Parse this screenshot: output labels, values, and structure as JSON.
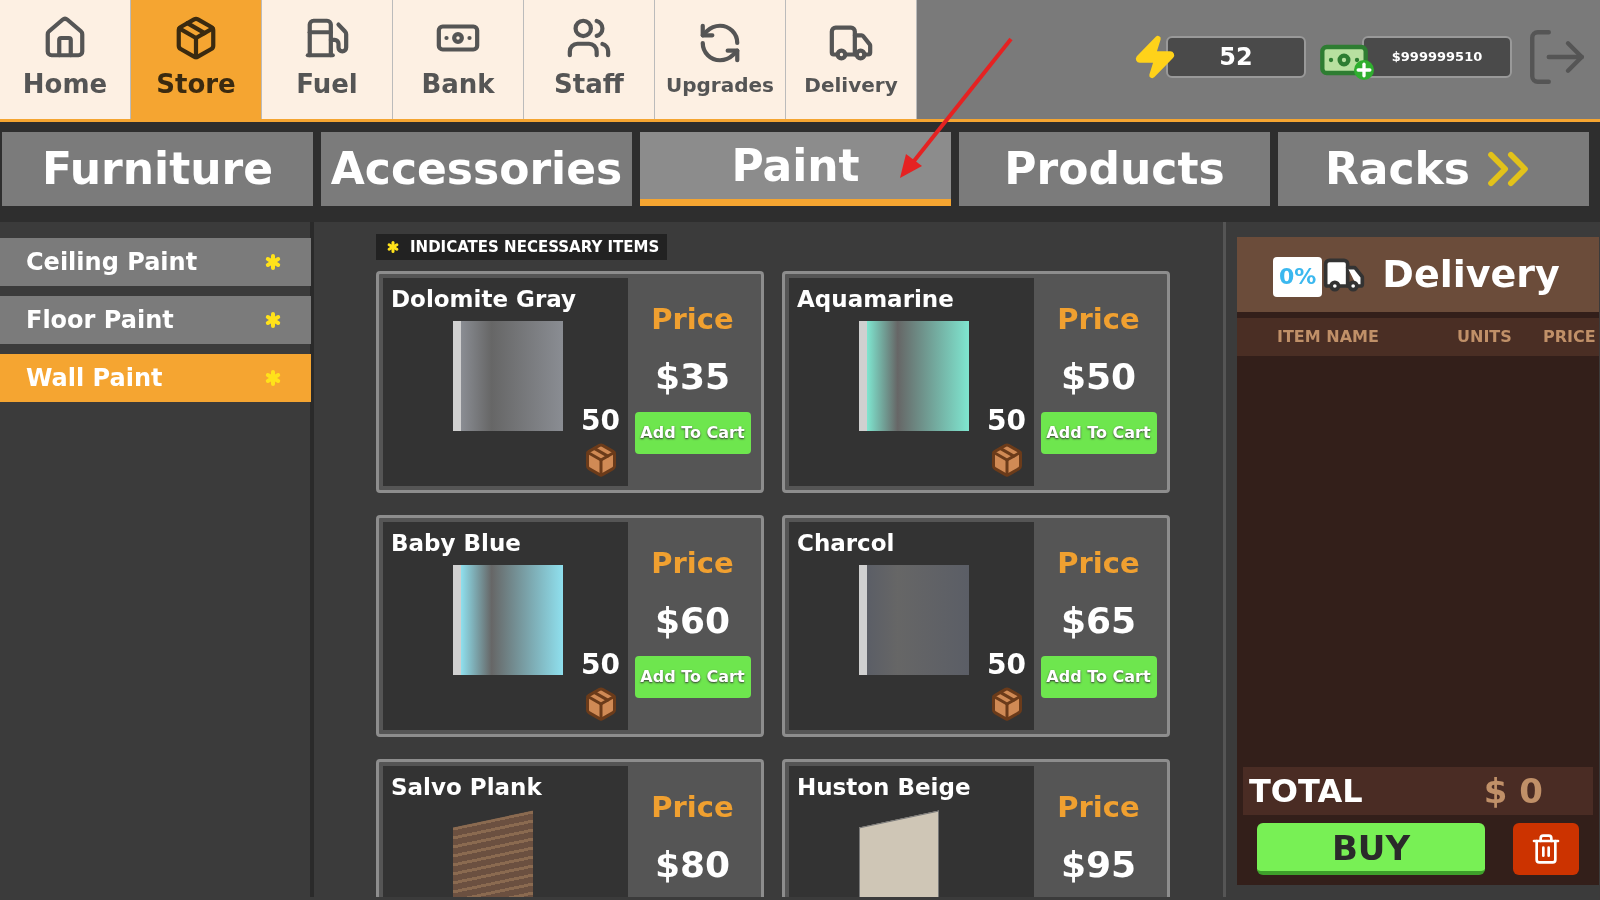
{
  "nav": [
    {
      "label": "Home",
      "selected": false
    },
    {
      "label": "Store",
      "selected": true
    },
    {
      "label": "Fuel",
      "selected": false
    },
    {
      "label": "Bank",
      "selected": false
    },
    {
      "label": "Staff",
      "selected": false
    },
    {
      "label": "Upgrades",
      "selected": false
    },
    {
      "label": "Delivery",
      "selected": false
    }
  ],
  "stats": {
    "energy": "52",
    "money": "$999999510"
  },
  "tabs": [
    {
      "label": "Furniture",
      "selected": false
    },
    {
      "label": "Accessories",
      "selected": false
    },
    {
      "label": "Paint",
      "selected": true
    },
    {
      "label": "Products",
      "selected": false
    },
    {
      "label": "Racks",
      "selected": false,
      "more": true
    }
  ],
  "sidebar": [
    {
      "label": "Ceiling Paint",
      "selected": false
    },
    {
      "label": "Floor Paint",
      "selected": false
    },
    {
      "label": "Wall Paint",
      "selected": true
    }
  ],
  "notice": "INDICATES NECESSARY ITEMS",
  "cards": [
    {
      "name": "Dolomite Gray",
      "kind": "panel",
      "color": "#8a8d93",
      "price_label": "Price",
      "price": "$35",
      "quantity": "50",
      "button": "Add To Cart"
    },
    {
      "name": "Aquamarine",
      "kind": "panel",
      "color": "#7fe6d0",
      "price_label": "Price",
      "price": "$50",
      "quantity": "50",
      "button": "Add To Cart"
    },
    {
      "name": "Baby Blue",
      "kind": "panel",
      "color": "#8fe0ee",
      "price_label": "Price",
      "price": "$60",
      "quantity": "50",
      "button": "Add To Cart"
    },
    {
      "name": "Charcol",
      "kind": "panel",
      "color": "#5b5e66",
      "price_label": "Price",
      "price": "$65",
      "quantity": "50",
      "button": "Add To Cart"
    },
    {
      "name": "Salvo Plank",
      "kind": "wood",
      "color": "#6b5040",
      "price_label": "Price",
      "price": "$80"
    },
    {
      "name": "Huston Beige",
      "kind": "stone",
      "color": "#cfc6b6",
      "price_label": "Price",
      "price": "$95"
    }
  ],
  "delivery": {
    "badge": "0%",
    "title": "Delivery",
    "columns": [
      "ITEM NAME",
      "UNITS",
      "PRICE"
    ],
    "total_label": "TOTAL",
    "total": "$ 0",
    "buy": "BUY"
  }
}
